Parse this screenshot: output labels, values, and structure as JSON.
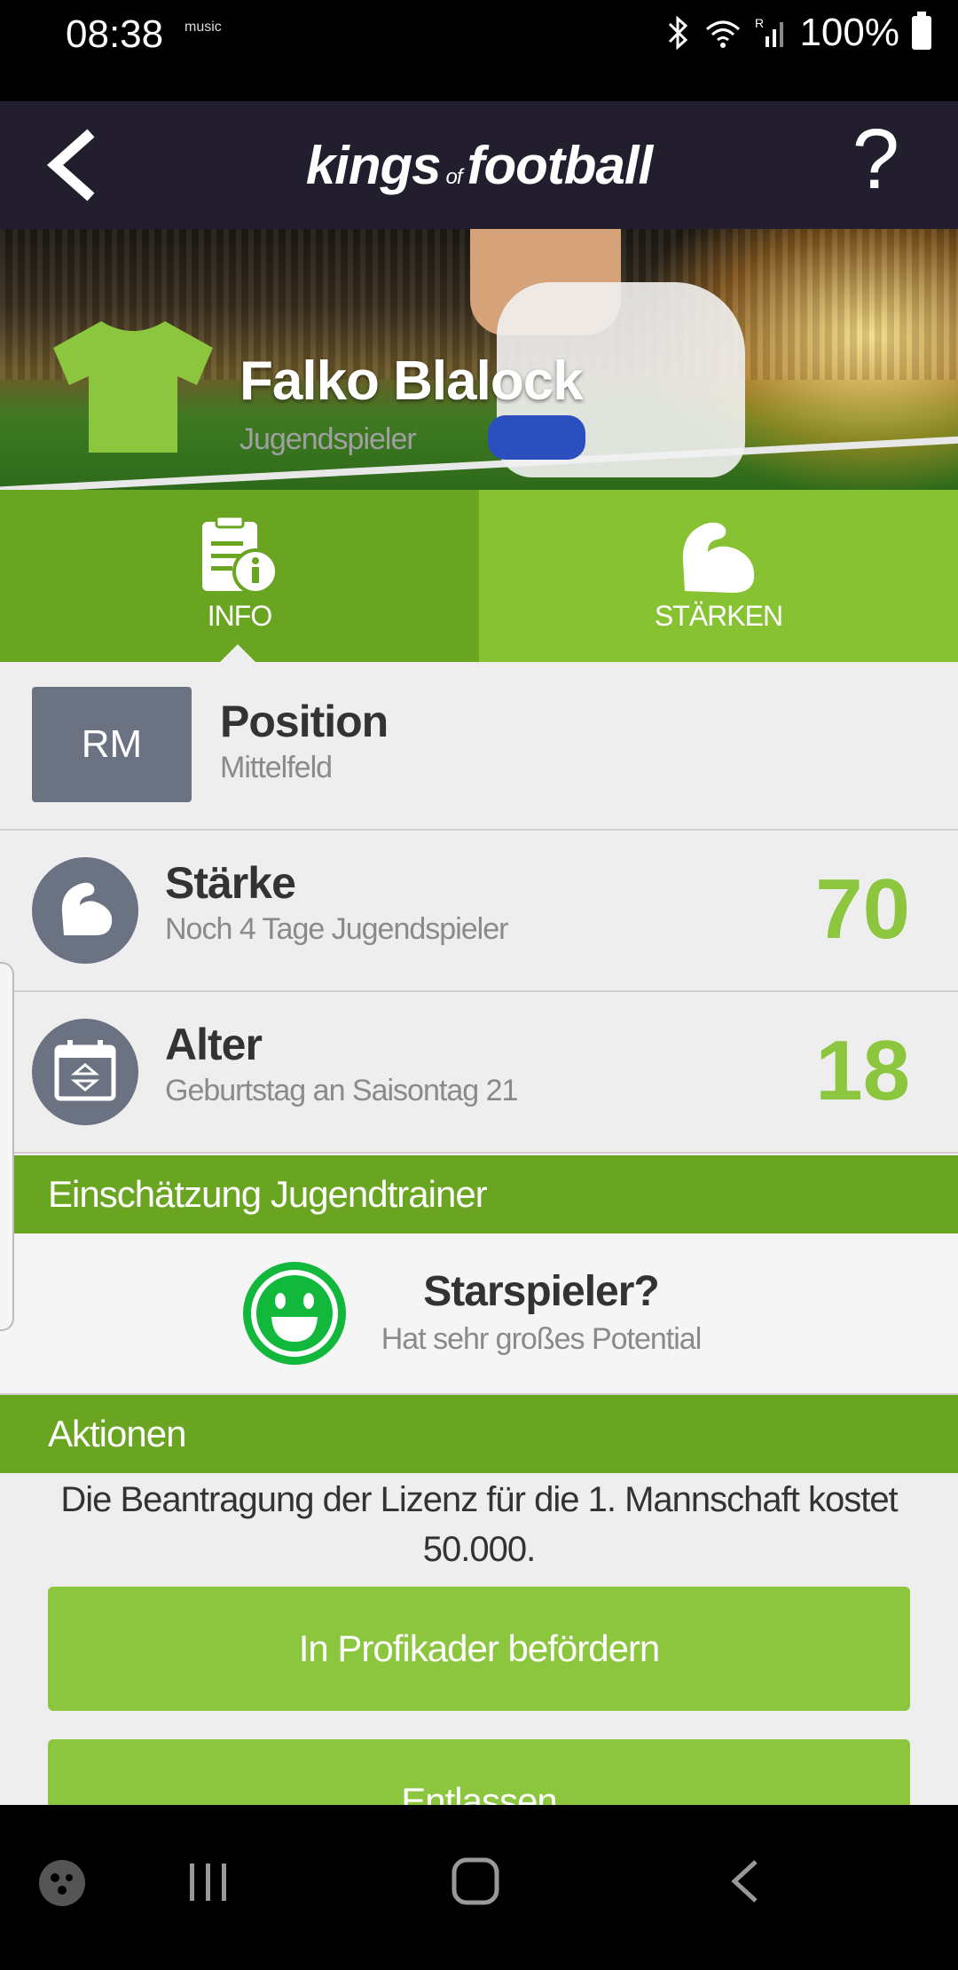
{
  "status_bar": {
    "time": "08:38",
    "music_label": "music",
    "battery": "100%"
  },
  "app_bar": {
    "logo_left": "kings",
    "logo_of": "of",
    "logo_right": "football",
    "help_label": "?"
  },
  "player": {
    "name": "Falko Blalock",
    "role": "Jugendspieler",
    "shirt_color": "#8cc63f"
  },
  "tabs": [
    {
      "label": "INFO",
      "icon": "info-document-icon",
      "active": true
    },
    {
      "label": "STÄRKEN",
      "icon": "flexed-arm-icon",
      "active": false
    }
  ],
  "position": {
    "badge": "RM",
    "title": "Position",
    "subtitle": "Mittelfeld"
  },
  "strength": {
    "title": "Stärke",
    "subtitle": "Noch 4 Tage Jugendspieler",
    "value": "70"
  },
  "age": {
    "title": "Alter",
    "subtitle": "Geburtstag an Saisontag 21",
    "value": "18"
  },
  "assessment": {
    "header": "Einschätzung Jugendtrainer",
    "title": "Starspieler?",
    "subtitle": "Hat sehr großes Potential"
  },
  "actions": {
    "header": "Aktionen",
    "license_text": "Die Beantragung der Lizenz für die 1. Mannschaft kostet 50.000.",
    "promote_button": "In Profikader befördern",
    "dismiss_button": "Entlassen"
  },
  "colors": {
    "accent_green": "#8cc63f",
    "dark_green": "#6aa521",
    "header_bg": "#221e2e",
    "badge_gray": "#6b7282"
  }
}
